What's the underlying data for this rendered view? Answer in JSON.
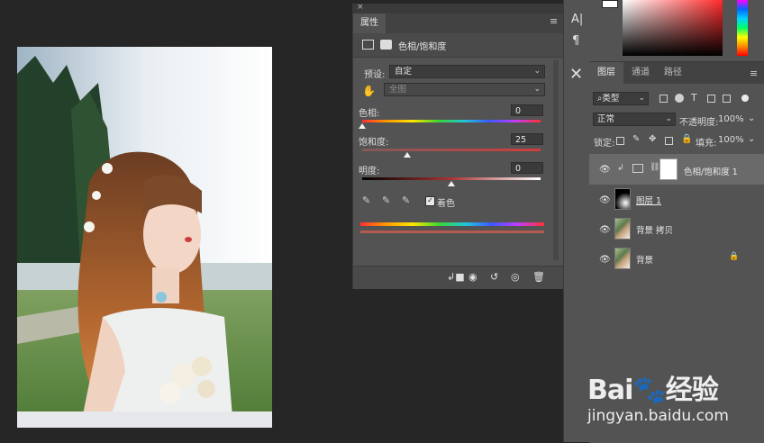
{
  "properties_panel": {
    "tab_label": "属性",
    "adjustment_title": "色相/饱和度",
    "preset_label": "预设:",
    "preset_value": "自定",
    "channel_value": "全图",
    "hue_label": "色相:",
    "hue_value": "0",
    "saturation_label": "饱和度:",
    "saturation_value": "25",
    "lightness_label": "明度:",
    "lightness_value": "0",
    "colorize_label": "着色",
    "colorize_checked": true,
    "hue_slider_fraction": 0.0,
    "saturation_slider_fraction": 0.25,
    "lightness_slider_fraction": 0.5
  },
  "layers_panel": {
    "tabs": [
      "图层",
      "通道",
      "路径"
    ],
    "filter_label": "类型",
    "blend_mode": "正常",
    "opacity_label": "不透明度:",
    "opacity_value": "100%",
    "lock_label": "锁定:",
    "fill_label": "填充:",
    "fill_value": "100%",
    "layers": [
      {
        "name": "色相/饱和度 1"
      },
      {
        "name": "图层 1"
      },
      {
        "name": "背景 拷贝"
      },
      {
        "name": "背景"
      }
    ]
  },
  "icons": {
    "close": "close-icon",
    "menu": "panel-menu-icon",
    "eye": "eye-icon",
    "lock": "lock-icon"
  },
  "watermark": {
    "logo_text": "Bai",
    "logo_paw": "🐾",
    "logo_cn": "经验",
    "url": "jingyan.baidu.com"
  },
  "colors": {
    "panel_bg": "#535353",
    "canvas_bg": "#262626",
    "selected_layer": "#6a6a6a"
  }
}
